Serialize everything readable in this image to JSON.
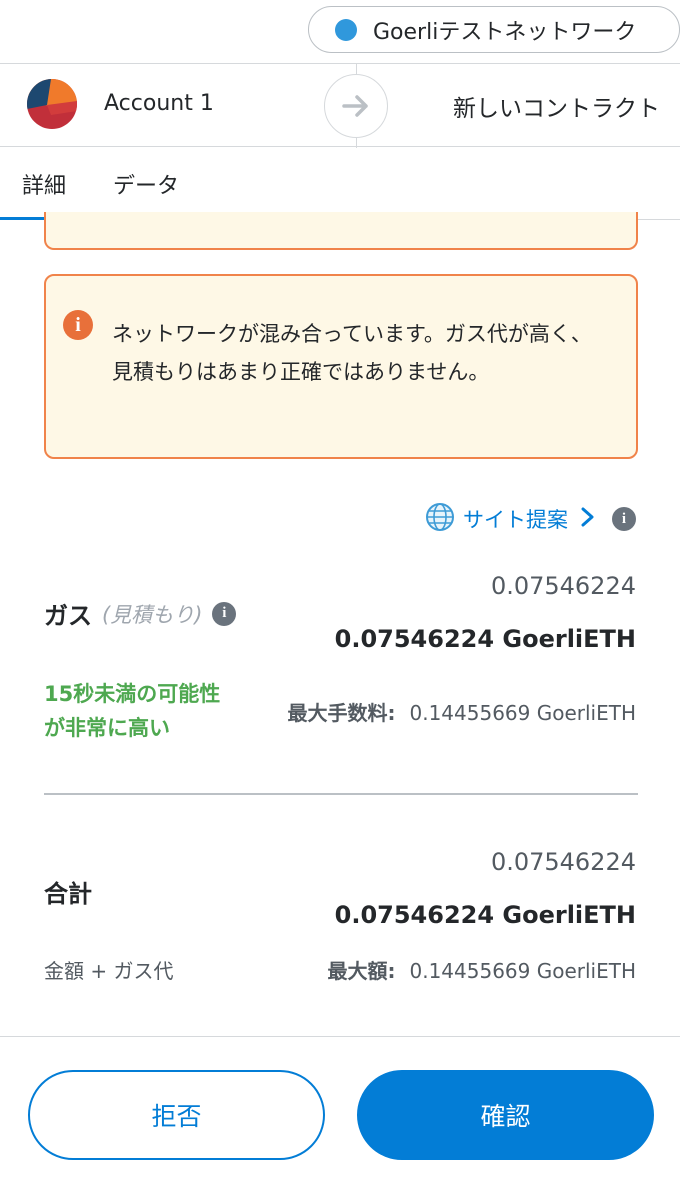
{
  "network": {
    "label": "Goerliテストネットワーク",
    "dot_color": "#3098dc"
  },
  "sender": {
    "account_name": "Account 1",
    "avatar_icon": "account-avatar-icon"
  },
  "recipient": {
    "label": "新しいコントラクト"
  },
  "tabs": [
    {
      "label": "詳細",
      "active": true
    },
    {
      "label": "データ",
      "active": false
    }
  ],
  "warning": {
    "text": "ネットワークが混み合っています。ガス代が高く、見積もりはあまり正確ではありません。",
    "icon": "info-circle-icon"
  },
  "site_suggestion": {
    "label": "サイト提案"
  },
  "gas": {
    "label": "ガス",
    "sublabel": "(見積もり)",
    "primary": "0.07546224",
    "secondary": "0.07546224 GoerliETH",
    "speed": "15秒未満の可能性が非常に高い",
    "max_fee_label": "最大手数料:",
    "max_fee_value": "0.14455669 GoerliETH"
  },
  "total": {
    "label": "合計",
    "primary": "0.07546224",
    "secondary": "0.07546224 GoerliETH",
    "sublabel": "金額 + ガス代",
    "max_amount_label": "最大額:",
    "max_amount_value": "0.14455669 GoerliETH"
  },
  "footer": {
    "reject_label": "拒否",
    "confirm_label": "確認"
  },
  "colors": {
    "accent": "#037dd6",
    "warning_border": "#f0834a",
    "warning_bg": "#fef8e6",
    "success": "#4ea850"
  }
}
